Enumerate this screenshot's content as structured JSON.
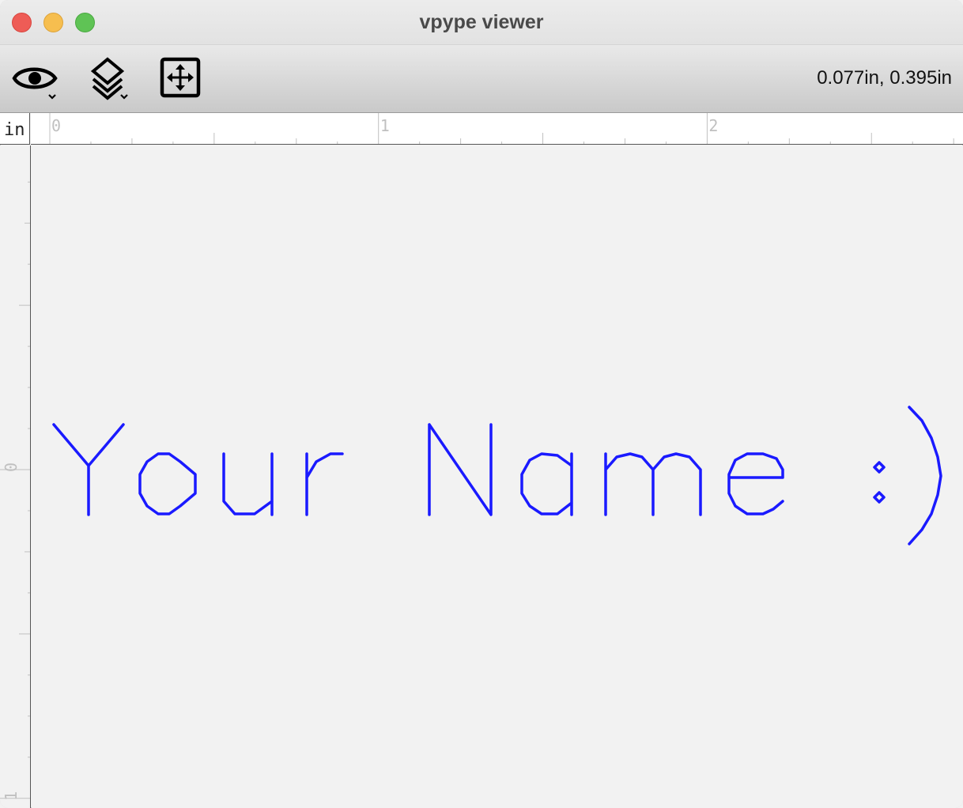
{
  "window": {
    "title": "vpype viewer",
    "controls": [
      "close",
      "minimize",
      "maximize"
    ]
  },
  "toolbar": {
    "buttons": [
      {
        "name": "view-options",
        "icon": "eye-icon",
        "has_dropdown": true
      },
      {
        "name": "layers",
        "icon": "layers-icon",
        "has_dropdown": true
      },
      {
        "name": "fit-to-page",
        "icon": "fit-icon",
        "has_dropdown": false
      }
    ],
    "cursor_coordinates": "0.077in, 0.395in"
  },
  "ruler": {
    "unit": "in",
    "horizontal_labels": [
      "0",
      "1",
      "2"
    ],
    "vertical_labels": [
      "0",
      "1"
    ]
  },
  "canvas": {
    "text": "Your Name :)",
    "stroke_color": "#1a1aff",
    "background_color": "#f2f2f2"
  }
}
